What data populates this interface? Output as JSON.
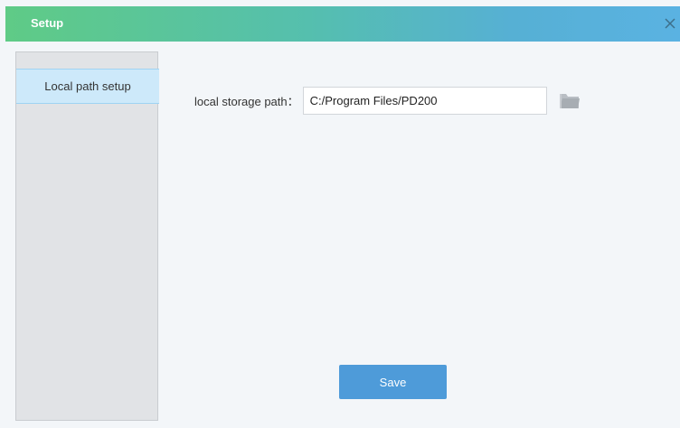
{
  "window": {
    "title": "Setup",
    "close_glyph": "×"
  },
  "sidebar": {
    "items": [
      {
        "label": "Local path setup",
        "selected": true
      }
    ]
  },
  "form": {
    "path_label": "local storage path：",
    "path_value": "C:/Program Files/PD200"
  },
  "actions": {
    "save_label": "Save"
  },
  "icons": {
    "close": "close-icon",
    "browse": "folder-icon"
  },
  "colors": {
    "title_gradient_start": "#5fcb86",
    "title_gradient_end": "#5ab2e2",
    "selected_item": "#cde9fa",
    "save_button": "#4e9bd9"
  }
}
